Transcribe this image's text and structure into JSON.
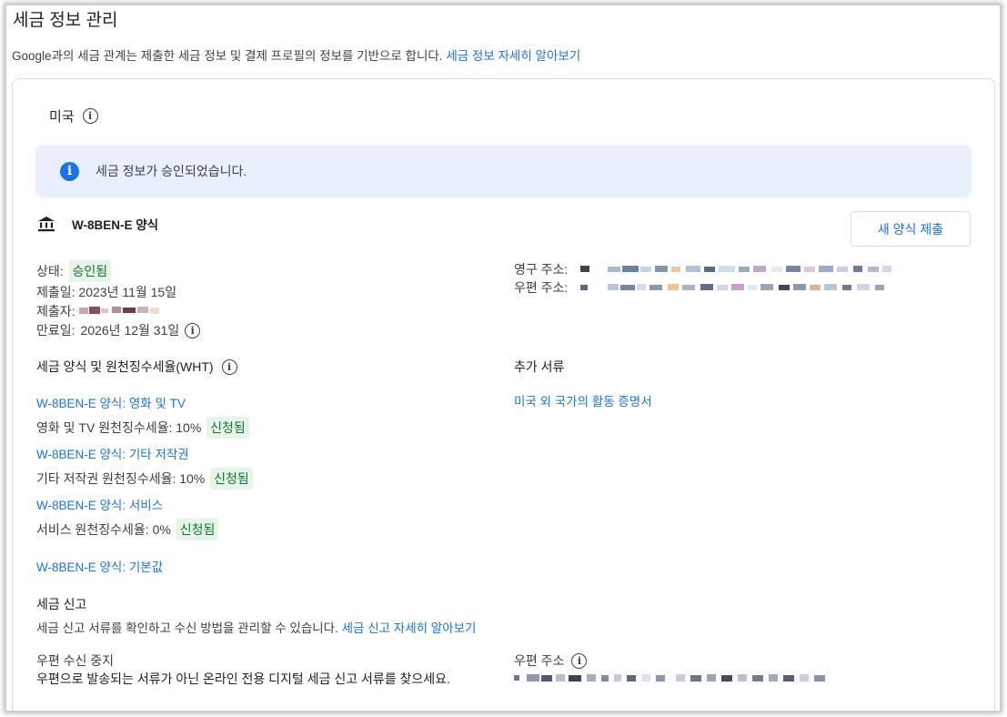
{
  "header": {
    "title": "세금 정보 관리",
    "intro_text": "Google과의 세금 관계는 제출한 세금 정보 및 결제 프로필의 정보를 기반으로 합니다.",
    "intro_link": "세금 정보 자세히 알아보기"
  },
  "country": {
    "name": "미국",
    "info_icon": "info-icon"
  },
  "banner": {
    "text": "세금 정보가 승인되었습니다.",
    "icon": "info-filled-icon"
  },
  "form": {
    "title": "W-8BEN-E 양식",
    "icon": "bank-icon",
    "new_form_button": "새 양식 제출",
    "status_label": "상태:",
    "status_value": "승인됨",
    "submitted_date_label": "제출일:",
    "submitted_date_value": "2023년 11월 15일",
    "submitter_label": "제출자:",
    "expiry_label": "만료일:",
    "expiry_value": "2026년 12월 31일",
    "permanent_address_label": "영구 주소:",
    "mailing_address_label": "우편 주소:"
  },
  "withholding": {
    "title": "세금 양식 및 원천징수세율(WHT)",
    "items": [
      {
        "link": "W-8BEN-E 양식: 영화 및 TV",
        "rate_text": "영화 및 TV 원천징수세율: 10%",
        "badge": "신청됨"
      },
      {
        "link": "W-8BEN-E 양식: 기타 저작권",
        "rate_text": "기타 저작권 원천징수세율: 10%",
        "badge": "신청됨"
      },
      {
        "link": "W-8BEN-E 양식: 서비스",
        "rate_text": "서비스 원천징수세율: 0%",
        "badge": "신청됨"
      }
    ],
    "default_link": "W-8BEN-E 양식: 기본값"
  },
  "additional_docs": {
    "title": "추가 서류",
    "link": "미국 외 국가의 활동 증명서"
  },
  "tax_filing": {
    "title": "세금 신고",
    "description": "세금 신고 서류를 확인하고 수신 방법을 관리할 수 있습니다.",
    "link": "세금 신고 자세히 알아보기",
    "mail_stop_title": "우편 수신 중지",
    "mail_stop_description": "우편으로 발송되는 서류가 아닌 온라인 전용 디지털 세금 신고 서류를 찾으세요.",
    "mailing_address_label": "우편 주소"
  },
  "colors": {
    "link": "#1a73e8",
    "badge_bg": "#e6f4ea",
    "badge_text": "#137333",
    "banner_bg": "#e8f0fe"
  }
}
